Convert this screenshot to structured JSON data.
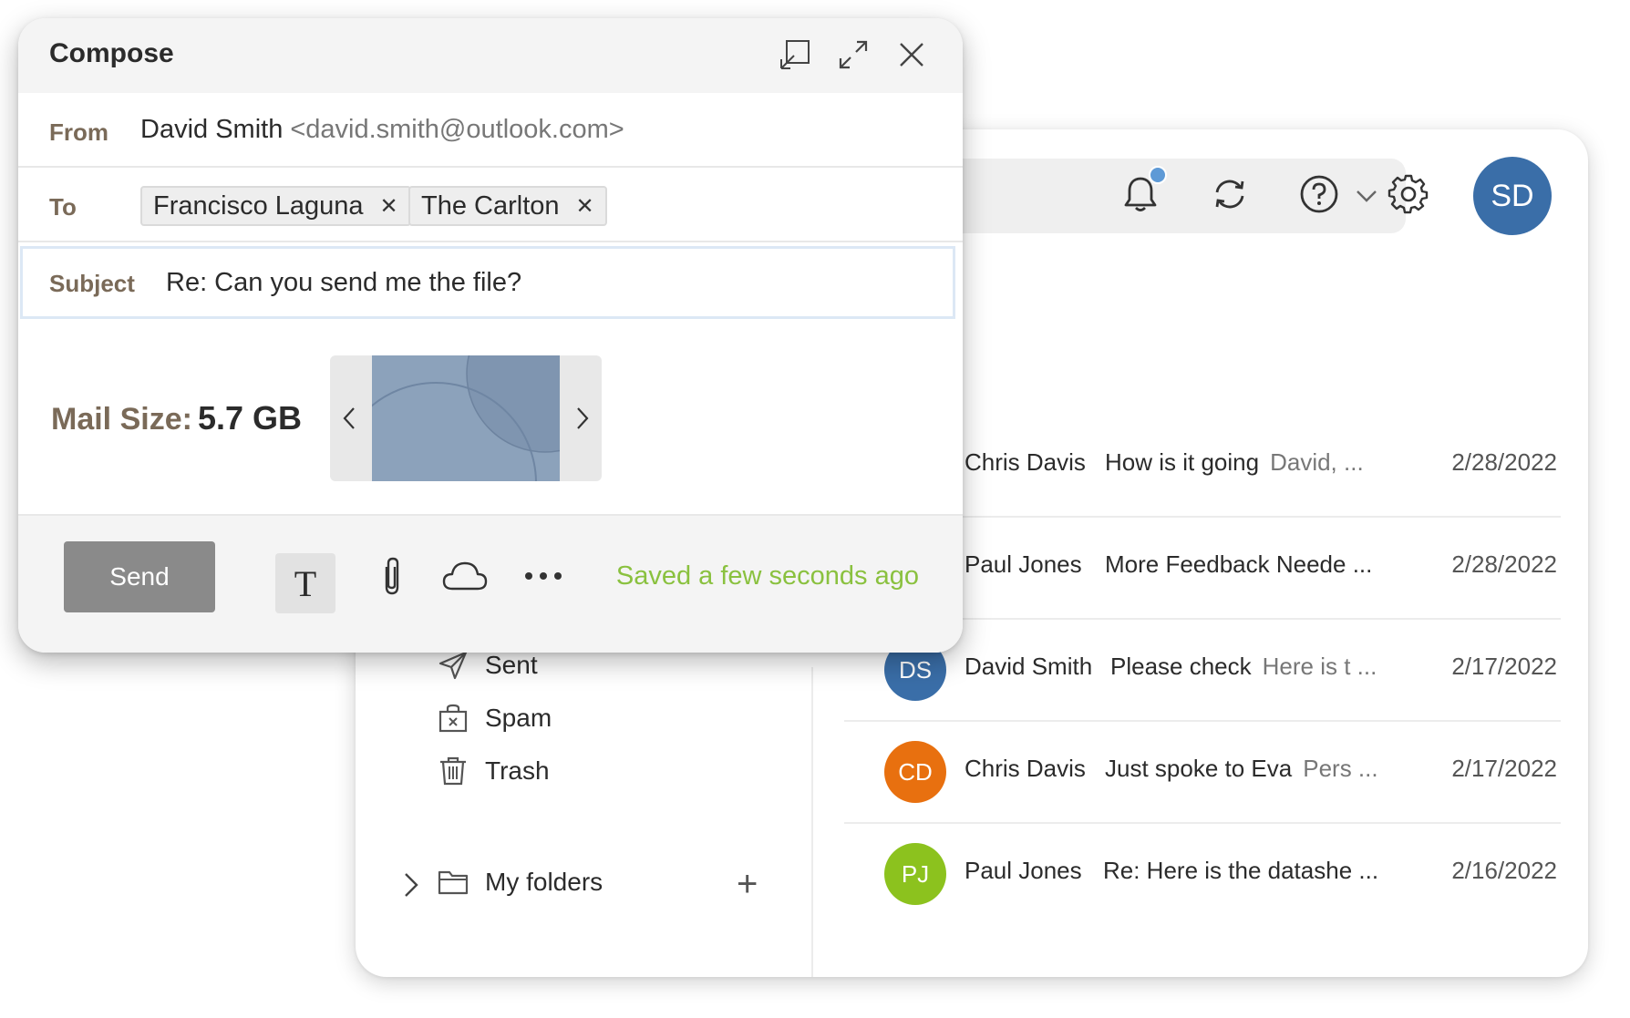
{
  "compose": {
    "title": "Compose",
    "from_label": "From",
    "from_name": "David Smith",
    "from_email": "<david.smith@outlook.com>",
    "to_label": "To",
    "recipients": [
      {
        "name": "Francisco Laguna",
        "remove": "✕"
      },
      {
        "name": "The Carlton",
        "remove": "✕"
      }
    ],
    "subject_label": "Subject",
    "subject_value": "Re: Can you send me the file?",
    "mail_size_label": "Mail Size:",
    "mail_size_value": "5.7 GB",
    "send_label": "Send",
    "format_label": "T",
    "saved_status": "Saved a few seconds ago"
  },
  "header": {
    "avatar_initials": "SD"
  },
  "folders": [
    {
      "label": "Sent",
      "icon": "send-icon"
    },
    {
      "label": "Spam",
      "icon": "spam-icon"
    },
    {
      "label": "Trash",
      "icon": "trash-icon"
    }
  ],
  "my_folders": {
    "label": "My folders",
    "add": "+"
  },
  "messages": [
    {
      "sender": "Chris Davis",
      "subject": "How is it going",
      "preview": "David, ...",
      "date": "2/28/2022",
      "initials": "",
      "color": ""
    },
    {
      "sender": "Paul Jones",
      "subject": "More Feedback Neede ...",
      "preview": "",
      "date": "2/28/2022",
      "initials": "",
      "color": ""
    },
    {
      "sender": "David Smith",
      "subject": "Please check",
      "preview": "Here is t ...",
      "date": "2/17/2022",
      "initials": "DS",
      "color": "#3a6ea8"
    },
    {
      "sender": "Chris Davis",
      "subject": "Just spoke to Eva",
      "preview": "Pers ...",
      "date": "2/17/2022",
      "initials": "CD",
      "color": "#e8700f"
    },
    {
      "sender": "Paul Jones",
      "subject": "Re: Here is the datashe ...",
      "preview": "",
      "date": "2/16/2022",
      "initials": "PJ",
      "color": "#8cc21e"
    }
  ],
  "colors": {
    "accent": "#3a6ea8",
    "saved": "#8ac13f",
    "send_button": "#8a8a8a",
    "notification_dot": "#5e9ad6"
  }
}
